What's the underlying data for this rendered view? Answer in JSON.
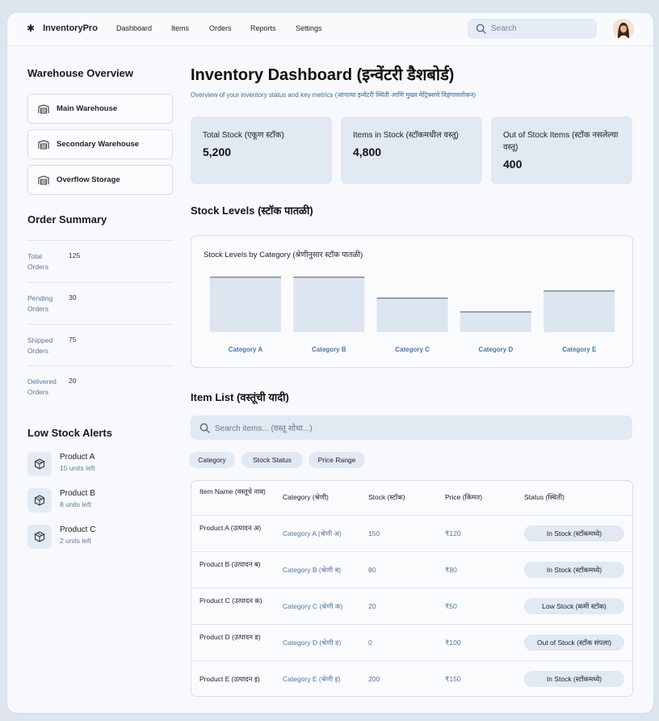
{
  "nav": {
    "brand": "InventoryPro",
    "links": [
      "Dashboard",
      "Items",
      "Orders",
      "Reports",
      "Settings"
    ],
    "search_placeholder": "Search"
  },
  "sidebar": {
    "warehouse_heading": "Warehouse Overview",
    "warehouses": [
      "Main Warehouse",
      "Secondary Warehouse",
      "Overflow Storage"
    ],
    "order_heading": "Order Summary",
    "orders": [
      {
        "label": "Total Orders",
        "value": "125"
      },
      {
        "label": "Pending Orders",
        "value": "30"
      },
      {
        "label": "Shipped Orders",
        "value": "75"
      },
      {
        "label": "Delivered Orders",
        "value": "20"
      }
    ],
    "alerts_heading": "Low Stock Alerts",
    "alerts": [
      {
        "name": "Product A",
        "units": "15 units left"
      },
      {
        "name": "Product B",
        "units": "8 units left"
      },
      {
        "name": "Product C",
        "units": "2 units left"
      }
    ]
  },
  "main": {
    "title": "Inventory Dashboard (इन्वेंटरी डैशबोर्ड)",
    "subtitle": "Overview of your inventory status and key metrics (आपल्या इन्वेंटरी स्थिती आणि मुख्य मेट्रिक्सचे विहंगावलोकन)",
    "stats": [
      {
        "label": "Total Stock (एकूण स्टॉक)",
        "value": "5,200"
      },
      {
        "label": "Items in Stock (स्टॉकमधील वस्तू)",
        "value": "4,800"
      },
      {
        "label": "Out of Stock Items (स्टॉक नसलेल्या वस्तू)",
        "value": "400"
      }
    ],
    "stock_heading": "Stock Levels (स्टॉक पातळी)",
    "items_heading": "Item List (वस्तूंची यादी)",
    "item_search_placeholder": "Search items... (वस्तू शोधा...)",
    "filters": [
      "Category",
      "Stock Status",
      "Price Range"
    ],
    "table": {
      "headers": [
        "Item Name (वस्तूचे नाव)",
        "Category (श्रेणी)",
        "Stock (स्टॉक)",
        "Price (किंमत)",
        "Status (स्थिती)"
      ],
      "rows": [
        {
          "name": "Product A (उत्पादन अ)",
          "category": "Category A (श्रेणी अ)",
          "stock": "150",
          "price": "₹120",
          "status": "In Stock (स्टॉकमध्ये)"
        },
        {
          "name": "Product B (उत्पादन ब)",
          "category": "Category B (श्रेणी ब)",
          "stock": "80",
          "price": "₹80",
          "status": "In Stock (स्टॉकमध्ये)"
        },
        {
          "name": "Product C (उत्पादन क)",
          "category": "Category C (श्रेणी क)",
          "stock": "20",
          "price": "₹50",
          "status": "Low Stock (कमी स्टॉक)"
        },
        {
          "name": "Product D (उत्पादन ड)",
          "category": "Category D (श्रेणी ड)",
          "stock": "0",
          "price": "₹100",
          "status": "Out of Stock (स्टॉक संपला)"
        },
        {
          "name": "Product E (उत्पादन इ)",
          "category": "Category E (श्रेणी इ)",
          "stock": "200",
          "price": "₹150",
          "status": "In Stock (स्टॉकमध्ये)"
        }
      ]
    }
  },
  "chart_data": {
    "type": "bar",
    "title": "Stock Levels by Category (श्रेणीनुसार स्टॉक पातळी)",
    "categories": [
      "Category A",
      "Category B",
      "Category C",
      "Category D",
      "Category E"
    ],
    "values": [
      100,
      100,
      62,
      37,
      75
    ],
    "ylim": [
      0,
      100
    ],
    "grid": false,
    "bar_color": "#dde6f0",
    "bar_top_color": "#6b7480",
    "label_color": "#4d77a6"
  },
  "colors": {
    "accent": "#4d77a6",
    "panel": "#e1e9f2"
  }
}
